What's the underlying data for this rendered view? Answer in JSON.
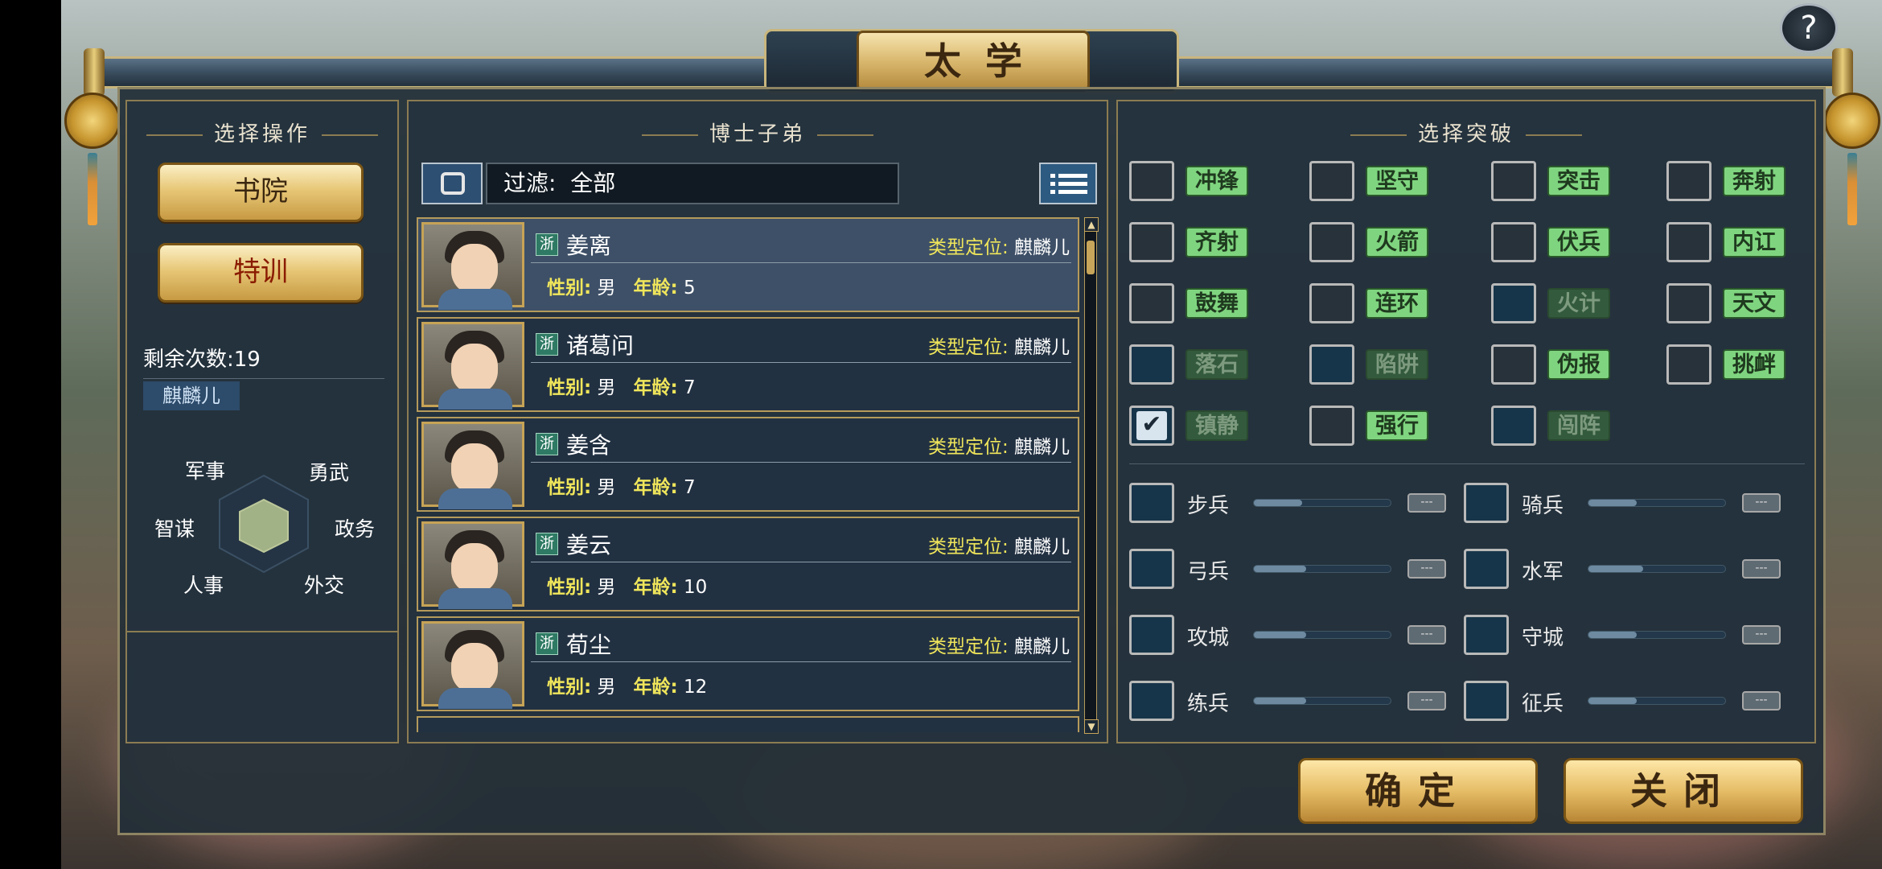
{
  "title": "太学",
  "help_label": "?",
  "left": {
    "header": "选择操作",
    "buttons": [
      {
        "label": "书院"
      },
      {
        "label": "特训"
      }
    ],
    "remaining": "剩余次数:19",
    "type_tag": "麒麟儿",
    "stats": [
      "军事",
      "勇武",
      "政务",
      "外交",
      "人事",
      "智谋"
    ]
  },
  "middle": {
    "header": "博士子弟",
    "filter": "过滤:  全部",
    "students": [
      {
        "tag": "浙",
        "name": "姜离",
        "type_label": "类型定位:",
        "type_value": "麒麟儿",
        "gender_label": "性别:",
        "gender": "男",
        "age_label": "年龄:",
        "age": "5"
      },
      {
        "tag": "浙",
        "name": "诸葛问",
        "type_label": "类型定位:",
        "type_value": "麒麟儿",
        "gender_label": "性别:",
        "gender": "男",
        "age_label": "年龄:",
        "age": "7"
      },
      {
        "tag": "浙",
        "name": "姜含",
        "type_label": "类型定位:",
        "type_value": "麒麟儿",
        "gender_label": "性别:",
        "gender": "男",
        "age_label": "年龄:",
        "age": "7"
      },
      {
        "tag": "浙",
        "name": "姜云",
        "type_label": "类型定位:",
        "type_value": "麒麟儿",
        "gender_label": "性别:",
        "gender": "男",
        "age_label": "年龄:",
        "age": "10"
      },
      {
        "tag": "浙",
        "name": "荀尘",
        "type_label": "类型定位:",
        "type_value": "麒麟儿",
        "gender_label": "性别:",
        "gender": "男",
        "age_label": "年龄:",
        "age": "12"
      }
    ]
  },
  "right": {
    "header": "选择突破",
    "skills": [
      {
        "name": "冲锋",
        "enabled": true,
        "checked": false
      },
      {
        "name": "坚守",
        "enabled": true,
        "checked": false
      },
      {
        "name": "突击",
        "enabled": true,
        "checked": false
      },
      {
        "name": "奔射",
        "enabled": true,
        "checked": false
      },
      {
        "name": "齐射",
        "enabled": true,
        "checked": false
      },
      {
        "name": "火箭",
        "enabled": true,
        "checked": false
      },
      {
        "name": "伏兵",
        "enabled": true,
        "checked": false
      },
      {
        "name": "内讧",
        "enabled": true,
        "checked": false
      },
      {
        "name": "鼓舞",
        "enabled": true,
        "checked": false
      },
      {
        "name": "连环",
        "enabled": true,
        "checked": false
      },
      {
        "name": "火计",
        "enabled": false,
        "checked": false
      },
      {
        "name": "天文",
        "enabled": true,
        "checked": false
      },
      {
        "name": "落石",
        "enabled": false,
        "checked": false
      },
      {
        "name": "陷阱",
        "enabled": false,
        "checked": false
      },
      {
        "name": "伪报",
        "enabled": true,
        "checked": false
      },
      {
        "name": "挑衅",
        "enabled": true,
        "checked": false
      },
      {
        "name": "镇静",
        "enabled": false,
        "checked": true
      },
      {
        "name": "强行",
        "enabled": true,
        "checked": false
      },
      {
        "name": "闯阵",
        "enabled": false,
        "checked": false
      }
    ],
    "troops": [
      {
        "name": "步兵",
        "level": 0.35
      },
      {
        "name": "骑兵",
        "level": 0.35
      },
      {
        "name": "弓兵",
        "level": 0.38
      },
      {
        "name": "水军",
        "level": 0.4
      },
      {
        "name": "攻城",
        "level": 0.38
      },
      {
        "name": "守城",
        "level": 0.35
      },
      {
        "name": "练兵",
        "level": 0.38
      },
      {
        "name": "征兵",
        "level": 0.35
      }
    ],
    "dash_label": "---"
  },
  "footer": {
    "confirm": "确定",
    "close": "关闭"
  }
}
